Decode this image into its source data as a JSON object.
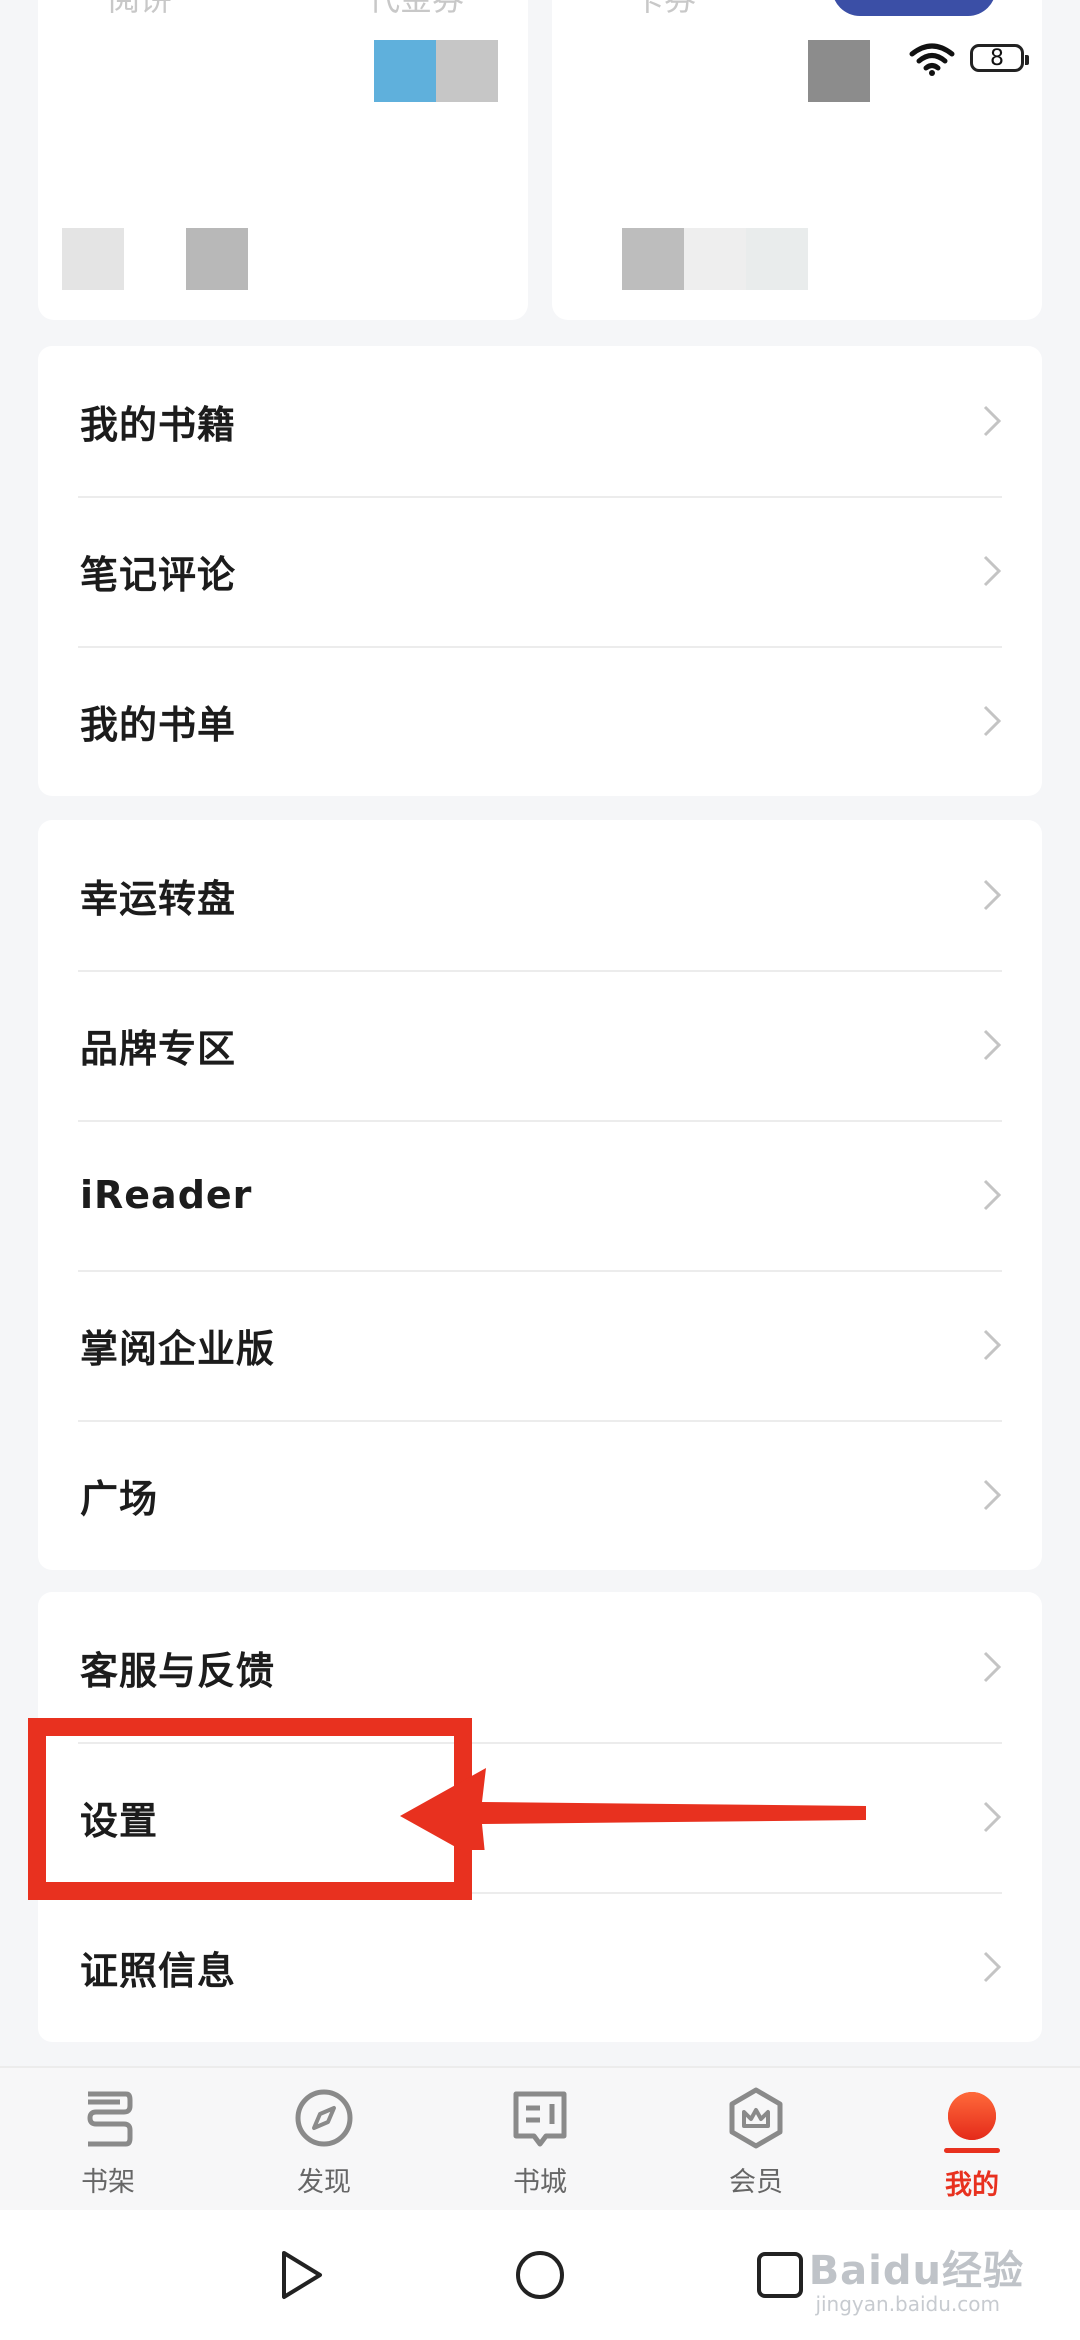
{
  "top_cards": {
    "left_labels": [
      "阅饼",
      "代金券"
    ],
    "right_labels": [
      "卡券"
    ]
  },
  "status_bar": {
    "battery_level": "8",
    "wifi_icon": "wifi-icon"
  },
  "groups": [
    {
      "items": [
        {
          "label": "我的书籍"
        },
        {
          "label": "笔记评论"
        },
        {
          "label": "我的书单"
        }
      ]
    },
    {
      "items": [
        {
          "label": "幸运转盘"
        },
        {
          "label": "品牌专区"
        },
        {
          "label": "iReader"
        },
        {
          "label": "掌阅企业版"
        },
        {
          "label": "广场"
        }
      ]
    },
    {
      "items": [
        {
          "label": "客服与反馈"
        },
        {
          "label": "设置"
        },
        {
          "label": "证照信息"
        }
      ]
    }
  ],
  "tabbar": {
    "tabs": [
      {
        "label": "书架",
        "icon": "bookshelf-icon"
      },
      {
        "label": "发现",
        "icon": "compass-icon"
      },
      {
        "label": "书城",
        "icon": "book-store-icon"
      },
      {
        "label": "会员",
        "icon": "vip-crown-icon"
      },
      {
        "label": "我的",
        "icon": "profile-icon",
        "active": true
      }
    ]
  },
  "navbar": {
    "buttons": [
      "back",
      "home",
      "recents"
    ]
  },
  "watermark": {
    "brand": "Baidu经验",
    "url": "jingyan.baidu.com"
  },
  "colors": {
    "accent": "#e8311f",
    "page_bg": "#f5f6f8",
    "card_bg": "#ffffff",
    "text": "#1c1c1c",
    "chevron": "#c4c4c4"
  }
}
